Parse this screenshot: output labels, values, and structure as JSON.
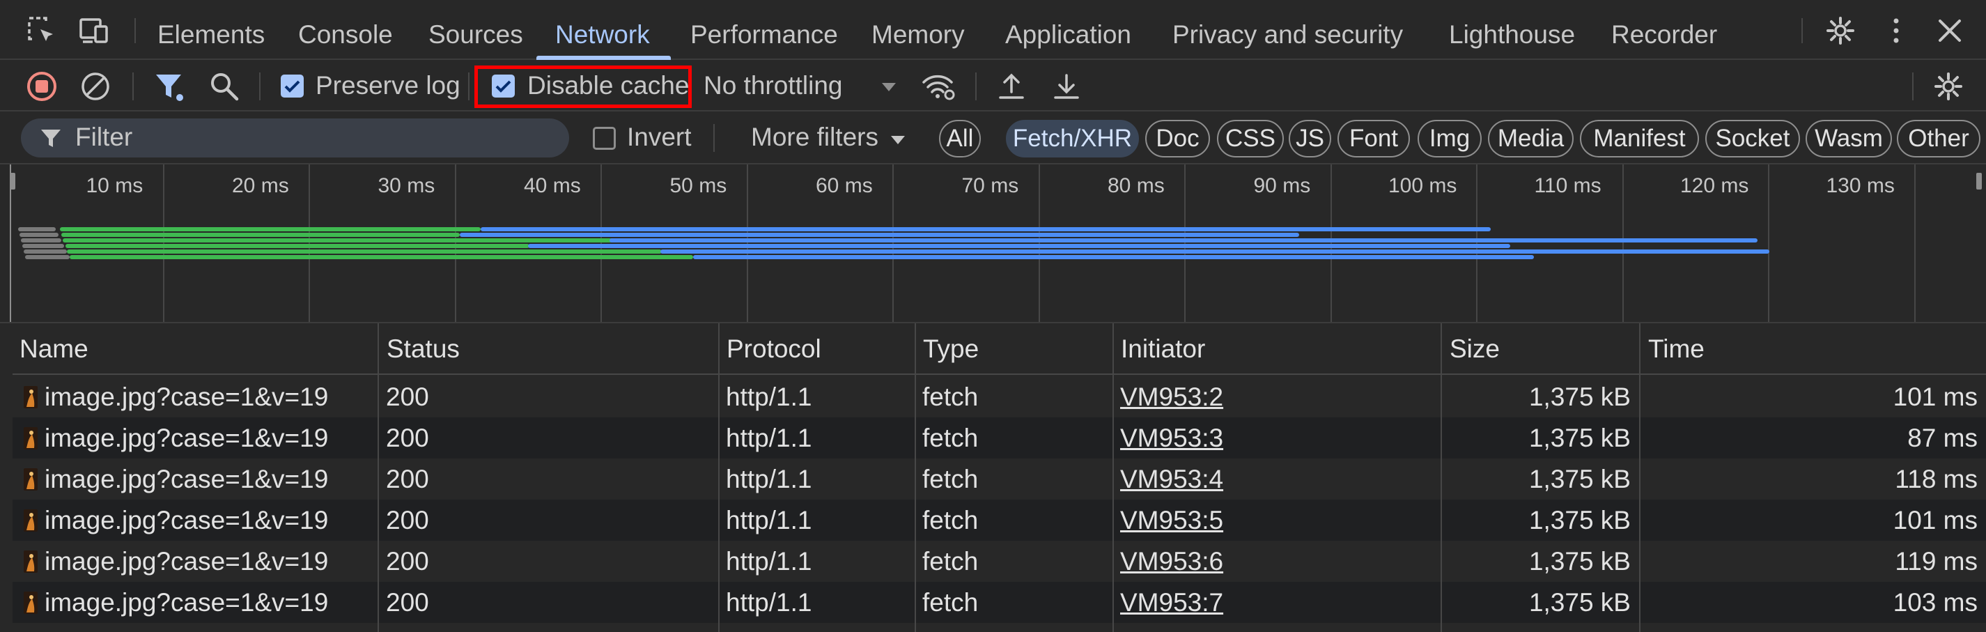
{
  "tabs": [
    {
      "label": "Elements"
    },
    {
      "label": "Console"
    },
    {
      "label": "Sources"
    },
    {
      "label": "Network",
      "active": true
    },
    {
      "label": "Performance"
    },
    {
      "label": "Memory"
    },
    {
      "label": "Application"
    },
    {
      "label": "Privacy and security"
    },
    {
      "label": "Lighthouse"
    },
    {
      "label": "Recorder"
    }
  ],
  "toolbar": {
    "preserve_log": {
      "label": "Preserve log",
      "checked": true
    },
    "disable_cache": {
      "label": "Disable cache",
      "checked": true
    },
    "throttling": "No throttling"
  },
  "filter": {
    "placeholder": "Filter",
    "invert_label": "Invert",
    "more_filters": "More filters",
    "types": [
      "All",
      "Fetch/XHR",
      "Doc",
      "CSS",
      "JS",
      "Font",
      "Img",
      "Media",
      "Manifest",
      "Socket",
      "Wasm",
      "Other"
    ],
    "active_type": "Fetch/XHR"
  },
  "overview": {
    "ticks": [
      "10 ms",
      "20 ms",
      "30 ms",
      "40 ms",
      "50 ms",
      "60 ms",
      "70 ms",
      "80 ms",
      "90 ms",
      "100 ms",
      "110 ms",
      "120 ms",
      "130 ms"
    ],
    "colors": {
      "waiting": "#3fb950",
      "download": "#4c8df6",
      "queue": "#7a7a7a"
    }
  },
  "table": {
    "columns": [
      "Name",
      "Status",
      "Protocol",
      "Type",
      "Initiator",
      "Size",
      "Time"
    ],
    "rows": [
      {
        "name": "image.jpg?case=1&v=19",
        "status": "200",
        "protocol": "http/1.1",
        "type": "fetch",
        "initiator": "VM953:2",
        "size": "1,375 kB",
        "time": "101 ms"
      },
      {
        "name": "image.jpg?case=1&v=19",
        "status": "200",
        "protocol": "http/1.1",
        "type": "fetch",
        "initiator": "VM953:3",
        "size": "1,375 kB",
        "time": "87 ms"
      },
      {
        "name": "image.jpg?case=1&v=19",
        "status": "200",
        "protocol": "http/1.1",
        "type": "fetch",
        "initiator": "VM953:4",
        "size": "1,375 kB",
        "time": "118 ms"
      },
      {
        "name": "image.jpg?case=1&v=19",
        "status": "200",
        "protocol": "http/1.1",
        "type": "fetch",
        "initiator": "VM953:5",
        "size": "1,375 kB",
        "time": "101 ms"
      },
      {
        "name": "image.jpg?case=1&v=19",
        "status": "200",
        "protocol": "http/1.1",
        "type": "fetch",
        "initiator": "VM953:6",
        "size": "1,375 kB",
        "time": "119 ms"
      },
      {
        "name": "image.jpg?case=1&v=19",
        "status": "200",
        "protocol": "http/1.1",
        "type": "fetch",
        "initiator": "VM953:7",
        "size": "1,375 kB",
        "time": "103 ms"
      }
    ]
  }
}
